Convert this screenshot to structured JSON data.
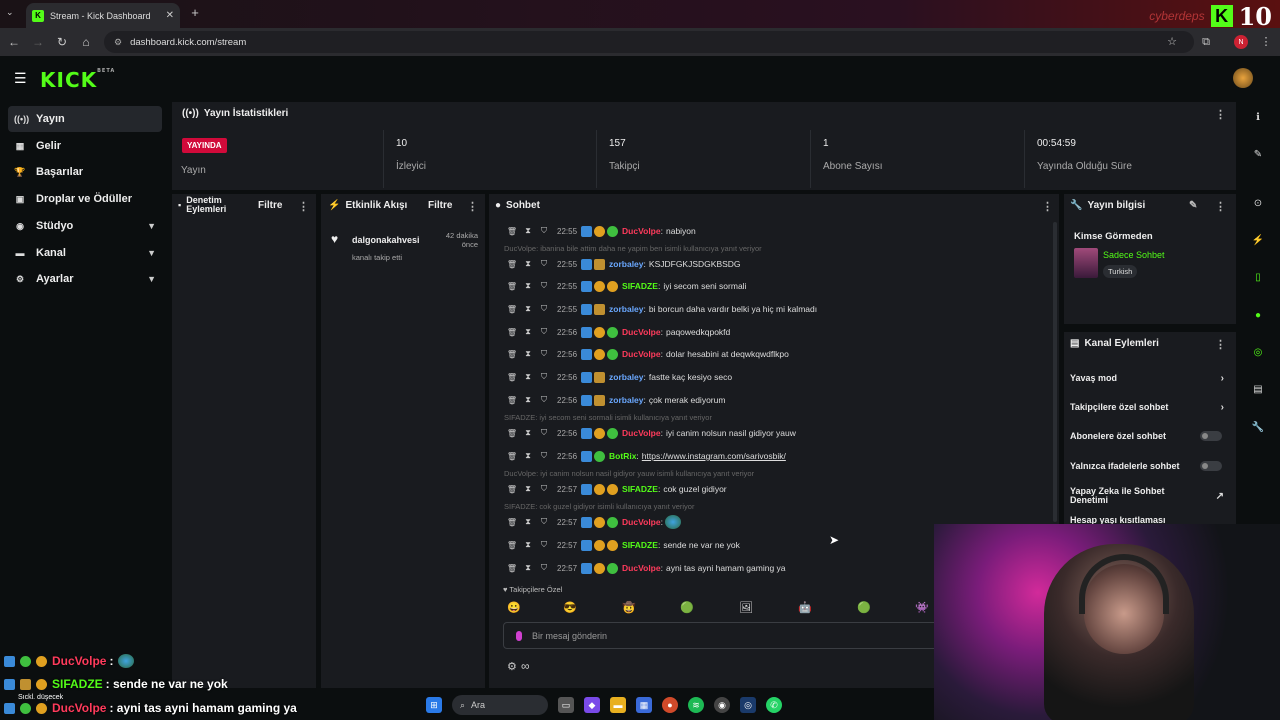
{
  "browser": {
    "tab_title": "Stream - Kick Dashboard",
    "url": "dashboard.kick.com/stream",
    "profile_initial": "N",
    "watermark": "cyberdeps",
    "corner_logo": "10"
  },
  "app": {
    "logo": "KICK",
    "logo_beta": "BETA"
  },
  "sidebar": {
    "items": [
      {
        "label": "Yayın",
        "icon": "broadcast-icon"
      },
      {
        "label": "Gelir",
        "icon": "money-icon"
      },
      {
        "label": "Başarılar",
        "icon": "trophy-icon"
      },
      {
        "label": "Droplar ve Ödüller",
        "icon": "gift-icon"
      },
      {
        "label": "Stüdyo",
        "icon": "studio-icon"
      },
      {
        "label": "Kanal",
        "icon": "channel-icon"
      },
      {
        "label": "Ayarlar",
        "icon": "gear-icon"
      }
    ]
  },
  "stats": {
    "title": "Yayın İstatistikleri",
    "live_badge": "YAYINDA",
    "live_label": "Yayın",
    "viewers": {
      "value": "10",
      "label": "İzleyici"
    },
    "followers": {
      "value": "157",
      "label": "Takipçi"
    },
    "subs": {
      "value": "1",
      "label": "Abone Sayısı"
    },
    "uptime": {
      "value": "00:54:59",
      "label": "Yayında Olduğu Süre"
    }
  },
  "moderation": {
    "title": "Denetim Eylemleri",
    "filter": "Filtre"
  },
  "activity": {
    "title": "Etkinlik Akışı",
    "filter": "Filtre",
    "events": [
      {
        "user": "dalgonakahvesi",
        "action": "kanalı takip etti",
        "time": "42 dakika önce"
      }
    ]
  },
  "chat": {
    "title": "Sohbet",
    "messages": [
      {
        "time": "22:55",
        "user": "DucVolpe",
        "color": "#ff3b5c",
        "text": "nabiyon",
        "badges": [
          "mod",
          "gold",
          "ver"
        ]
      },
      {
        "reply": "DucVolpe: ibanina bile attim daha ne yapim ben isimli kullanıcıya yanıt veriyor"
      },
      {
        "time": "22:55",
        "user": "zorbaley",
        "color": "#6aa8ff",
        "text": "KSJDFGKJSDGKBSDG",
        "badges": [
          "mod",
          "crown"
        ]
      },
      {
        "time": "22:55",
        "user": "SIFADZE",
        "color": "#53fc18",
        "text": "iyi secom seni sormali",
        "badges": [
          "mod",
          "gold",
          "mst"
        ]
      },
      {
        "time": "22:55",
        "user": "zorbaley",
        "color": "#6aa8ff",
        "text": "bi borcun daha vardır belki ya hiç mi kalmadı",
        "badges": [
          "mod",
          "crown"
        ]
      },
      {
        "time": "22:56",
        "user": "DucVolpe",
        "color": "#ff3b5c",
        "text": "paqowedkqpokfd",
        "badges": [
          "mod",
          "gold",
          "ver"
        ]
      },
      {
        "time": "22:56",
        "user": "DucVolpe",
        "color": "#ff3b5c",
        "text": "dolar hesabini at deqwkqwdflkpo",
        "badges": [
          "mod",
          "gold",
          "ver"
        ]
      },
      {
        "time": "22:56",
        "user": "zorbaley",
        "color": "#6aa8ff",
        "text": "fastte kaç kesiyo seco",
        "badges": [
          "mod",
          "crown"
        ]
      },
      {
        "time": "22:56",
        "user": "zorbaley",
        "color": "#6aa8ff",
        "text": "çok merak ediyorum",
        "badges": [
          "mod",
          "crown"
        ]
      },
      {
        "reply": "SIFADZE: iyi secom seni sormali isimli kullanıcıya yanıt veriyor"
      },
      {
        "time": "22:56",
        "user": "DucVolpe",
        "color": "#ff3b5c",
        "text": "iyi canim nolsun nasil gidiyor yauw",
        "badges": [
          "mod",
          "gold",
          "ver"
        ]
      },
      {
        "time": "22:56",
        "user": "BotRix",
        "color": "#53fc18",
        "text": "https://www.instagram.com/sarivosbik/",
        "badges": [
          "mod",
          "ver"
        ]
      },
      {
        "reply": "DucVolpe: iyi canim nolsun nasil gidiyor yauw isimli kullanıcıya yanıt veriyor"
      },
      {
        "time": "22:57",
        "user": "SIFADZE",
        "color": "#53fc18",
        "text": "cok guzel gidiyor",
        "badges": [
          "mod",
          "gold",
          "mst"
        ]
      },
      {
        "reply": "SIFADZE: cok guzel gidiyor isimli kullanıcıya yanıt veriyor"
      },
      {
        "time": "22:57",
        "user": "DucVolpe",
        "color": "#ff3b5c",
        "text": "",
        "badges": [
          "mod",
          "gold",
          "ver"
        ],
        "emote": true
      },
      {
        "time": "22:57",
        "user": "SIFADZE",
        "color": "#53fc18",
        "text": "sende ne var ne yok",
        "badges": [
          "mod",
          "gold",
          "mst"
        ]
      },
      {
        "time": "22:57",
        "user": "DucVolpe",
        "color": "#ff3b5c",
        "text": "ayni tas ayni hamam gaming ya",
        "badges": [
          "mod",
          "gold",
          "ver"
        ]
      }
    ],
    "followers_only_label": "Takipçilere Özel",
    "input_placeholder": "Bir mesaj gönderin"
  },
  "stream_info": {
    "title": "Yayın bilgisi",
    "stream_title": "Kimse Görmeden",
    "category": "Sadece Sohbet",
    "language": "Turkish"
  },
  "channel_actions": {
    "title": "Kanal Eylemleri",
    "items": [
      {
        "label": "Yavaş mod",
        "kind": "arrow"
      },
      {
        "label": "Takipçilere özel sohbet",
        "kind": "arrow"
      },
      {
        "label": "Abonelere özel sohbet",
        "kind": "toggle"
      },
      {
        "label": "Yalnızca ifadelerle sohbet",
        "kind": "toggle"
      },
      {
        "label": "Yapay Zeka ile Sohbet Denetimi",
        "kind": "link"
      },
      {
        "label": "Hesap yaşı kısıtlaması",
        "kind": "arrow"
      }
    ]
  },
  "overlay_chat": [
    {
      "user": "DucVolpe",
      "color": "#ff3b5c",
      "text": ":"
    },
    {
      "user": "SIFADZE",
      "color": "#53fc18",
      "text": ": sende ne var ne yok"
    },
    {
      "user": "DucVolpe",
      "color": "#ff3b5c",
      "text": ": ayni tas ayni hamam gaming ya"
    }
  ],
  "overlay_note": "Sıckl. düşecek",
  "taskbar": {
    "search_label": "Ara"
  }
}
